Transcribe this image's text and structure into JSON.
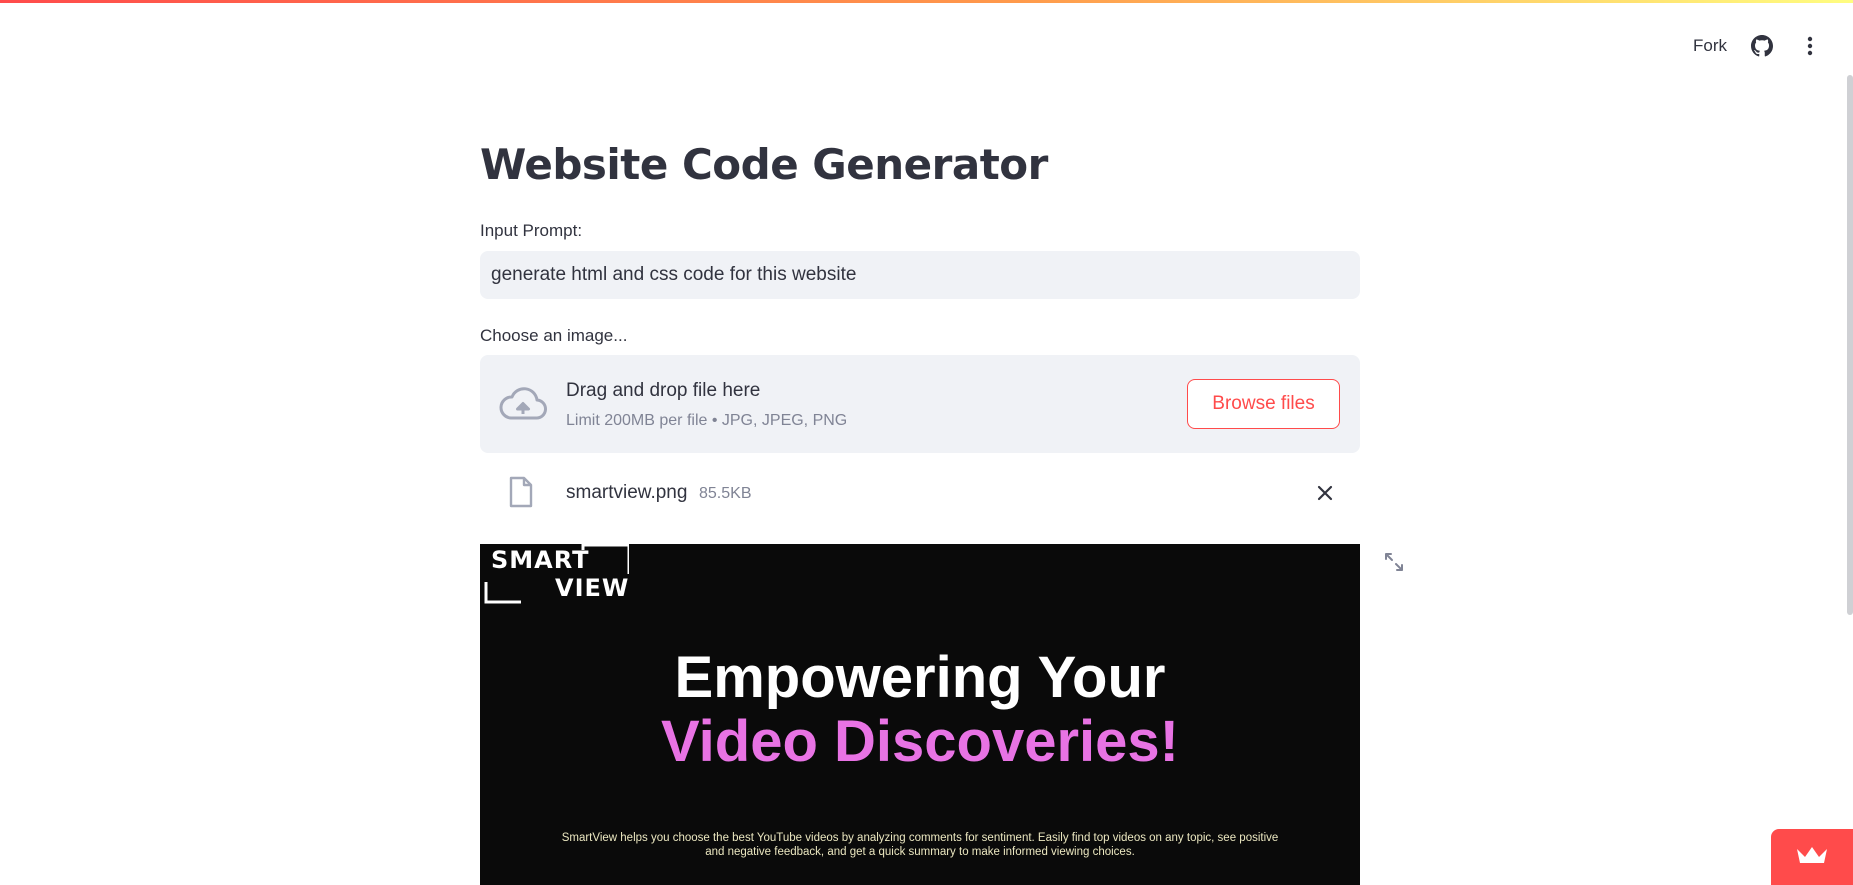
{
  "toolbar": {
    "fork_label": "Fork",
    "github_icon": "github-icon",
    "menu_icon": "more-vertical-icon"
  },
  "page": {
    "title": "Website Code Generator"
  },
  "prompt": {
    "label": "Input Prompt:",
    "value": "generate html and css code for this website"
  },
  "uploader": {
    "label": "Choose an image...",
    "upload_icon": "cloud-upload-icon",
    "title": "Drag and drop file here",
    "subtitle": "Limit 200MB per file • JPG, JPEG, PNG",
    "browse_label": "Browse files",
    "file": {
      "icon": "file-icon",
      "name": "smartview.png",
      "size": "85.5KB",
      "remove_icon": "close-icon"
    }
  },
  "preview": {
    "logo_line_1": "SMART",
    "logo_line_2": "VIEW",
    "hero_line_1": "Empowering Your",
    "hero_line_2": "Video Discoveries!",
    "description": "SmartView helps you choose the best YouTube videos by analyzing comments for sentiment. Easily find top videos on any topic, see positive and negative feedback, and get a quick summary to make informed viewing choices.",
    "fullscreen_icon": "expand-icon"
  },
  "badge": {
    "icon": "crown-icon"
  },
  "colors": {
    "accent": "#ff4b4b",
    "input_bg": "#f0f2f6",
    "text": "#31333f",
    "muted": "#808495",
    "hero_highlight": "#e873e4"
  }
}
